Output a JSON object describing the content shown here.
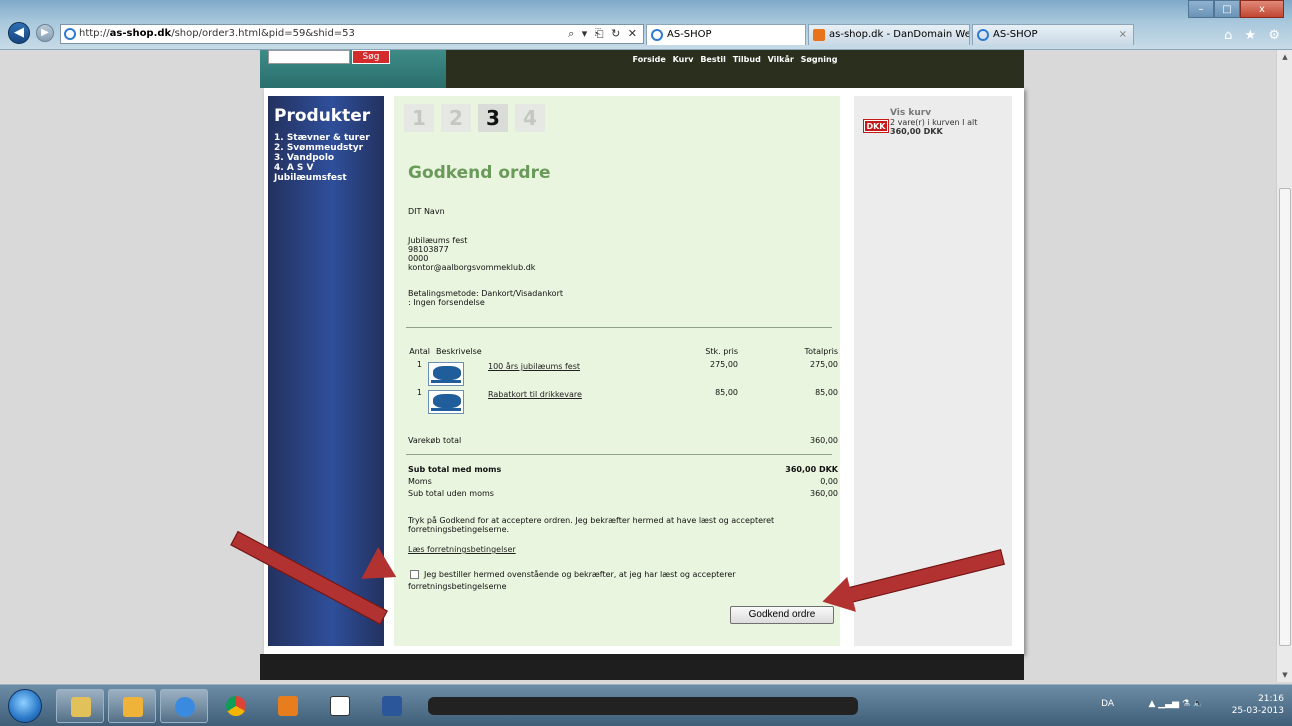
{
  "browser": {
    "url_prefix": "http://",
    "url_host": "as-shop.dk",
    "url_path": "/shop/order3.html&pid=59&shid=53",
    "url_tools": "⌕ ▾ ⎗ ↻ ✕",
    "tabs": [
      {
        "label": "AS-SHOP",
        "icon": "ie-icon"
      },
      {
        "label": "as-shop.dk - DanDomain Web...",
        "icon": "dandomain-icon"
      },
      {
        "label": "AS-SHOP",
        "icon": "ie-icon"
      }
    ],
    "window_buttons": [
      "–",
      "□",
      "x"
    ],
    "chrome_icons": "⌂ ★ ⚙"
  },
  "site": {
    "search_button": "Søg",
    "nav": [
      "Forside",
      "Kurv",
      "Bestil",
      "Tilbud",
      "Vilkår",
      "Søgning"
    ]
  },
  "sidebar": {
    "title": "Produkter",
    "items": [
      "1. Stævner & turer",
      "2. Svømmeudstyr",
      "3. Vandpolo",
      "4. A S V",
      "Jubilæumsfest"
    ]
  },
  "steps": [
    "1",
    "2",
    "3",
    "4"
  ],
  "order": {
    "title": "Godkend ordre",
    "name": "DIT Navn",
    "address_lines": [
      "Jubilæums fest",
      "98103877",
      "0000",
      "kontor@aalborgsvommeklub.dk"
    ],
    "payment": "Betalingsmetode: Dankort/Visadankort",
    "shipping": ": Ingen forsendelse",
    "headers": {
      "antal": "Antal",
      "desc": "Beskrivelse",
      "price": "Stk. pris",
      "total": "Totalpris"
    },
    "items": [
      {
        "qty": "1",
        "name": "100 års jubilæums fest",
        "price": "275,00",
        "total": "275,00"
      },
      {
        "qty": "1",
        "name": "Rabatkort til drikkevare",
        "price": "85,00",
        "total": "85,00"
      }
    ],
    "varekob_label": "Varekøb total",
    "varekob_value": "360,00",
    "subtotal_label": "Sub total med moms",
    "subtotal_value": "360,00 DKK",
    "moms_label": "Moms",
    "moms_value": "0,00",
    "subtotal_ex_label": "Sub total uden moms",
    "subtotal_ex_value": "360,00",
    "terms_text": "Tryk på Godkend for at acceptere ordren. Jeg bekræfter hermed at have læst og accepteret forretningsbetingelserne.",
    "terms_link": "Læs forretningsbetingelser",
    "checkbox_text": "Jeg bestiller hermed ovenstående og bekræfter, at jeg har læst og accepterer",
    "checkbox_text2": "forretningsbetingelserne",
    "approve_button": "Godkend ordre"
  },
  "cart": {
    "badge": "DKK",
    "title": "Vis kurv",
    "text_prefix": "2 vare(r) i kurven  I alt ",
    "total": "360,00 DKK"
  },
  "taskbar": {
    "lang": "DA",
    "time": "21:16",
    "date": "25-03-2013"
  },
  "colors": {
    "accent_green": "#6a9a5a",
    "main_bg": "#eaf5df",
    "sidebar_blue": "#2f4f9b",
    "arrow_red": "#b23131"
  }
}
